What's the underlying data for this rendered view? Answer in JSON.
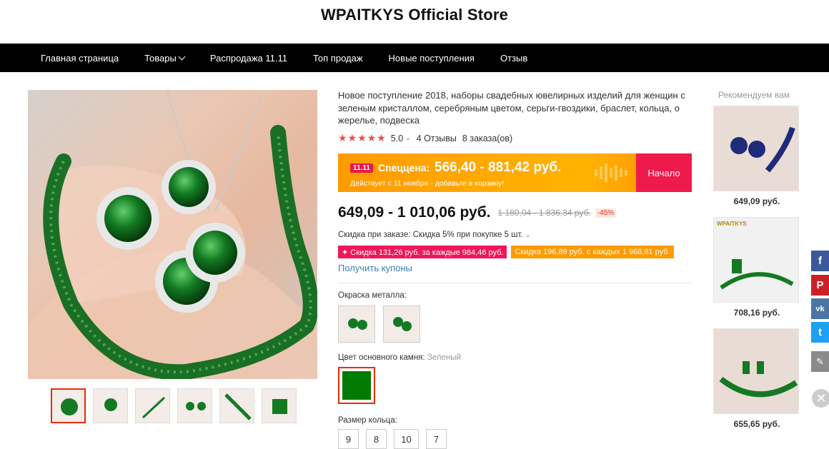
{
  "store": {
    "title": "WPAITKYS Official Store"
  },
  "nav": {
    "items": [
      {
        "label": "Главная страница"
      },
      {
        "label": "Товары",
        "has_dropdown": true
      },
      {
        "label": "Распродажа 11.11"
      },
      {
        "label": "Топ продаж"
      },
      {
        "label": "Новые поступления"
      },
      {
        "label": "Отзыв"
      }
    ]
  },
  "product": {
    "title": "Новое поступление 2018, наборы свадебных ювелирных изделий для женщин с зеленым кристаллом, серебряным цветом, серьги-гвоздики, браслет, кольца, о жерелье, подвеска",
    "stars": "★★★★★",
    "rating": "5.0",
    "reviews": "4 Отзывы",
    "orders": "8 заказа(ов)",
    "sale": {
      "badge": "11.11",
      "label": "Спеццена:",
      "price": "566,40 - 881,42 руб.",
      "subtitle": "Действует с 11 ноября - добавьте в корзину!",
      "button": "Начало"
    },
    "price": "649,09 - 1 010,06 руб.",
    "old_price": "1 180,04 - 1 836,34 руб.",
    "discount": "-45%",
    "bulk_discount": "Скидка при заказе: Скидка 5% при покупке 5 шт.",
    "coupons": [
      "✦ Скидка 131,26 руб. за каждые 984,46 руб.",
      "Скидка 196,89 руб. с каждых 1 968,91 руб."
    ],
    "get_coupons": "Получить купоны",
    "metal_color_label": "Окраска металла:",
    "stone_color_label": "Цвет основного камня:",
    "stone_color_value": "Зеленый",
    "stone_color_hex": "#007a00",
    "ring_size_label": "Размер кольца:",
    "ring_sizes": [
      "9",
      "8",
      "10",
      "7"
    ]
  },
  "recommend": {
    "title": "Рекомендуем вам",
    "items": [
      {
        "price": "649,09 руб."
      },
      {
        "price": "708,16 руб."
      },
      {
        "price": "655,65 руб."
      }
    ],
    "brand_mark": "WPAITKYS"
  },
  "social": {
    "icons": [
      "facebook-icon",
      "pinterest-icon",
      "vk-icon",
      "twitter-icon",
      "edit-icon",
      "close-icon"
    ],
    "colors": {
      "facebook": "#3b5998",
      "pinterest": "#cb2027",
      "vk": "#4c75a3",
      "twitter": "#1da1f2",
      "edit": "#8a8a8a"
    }
  }
}
